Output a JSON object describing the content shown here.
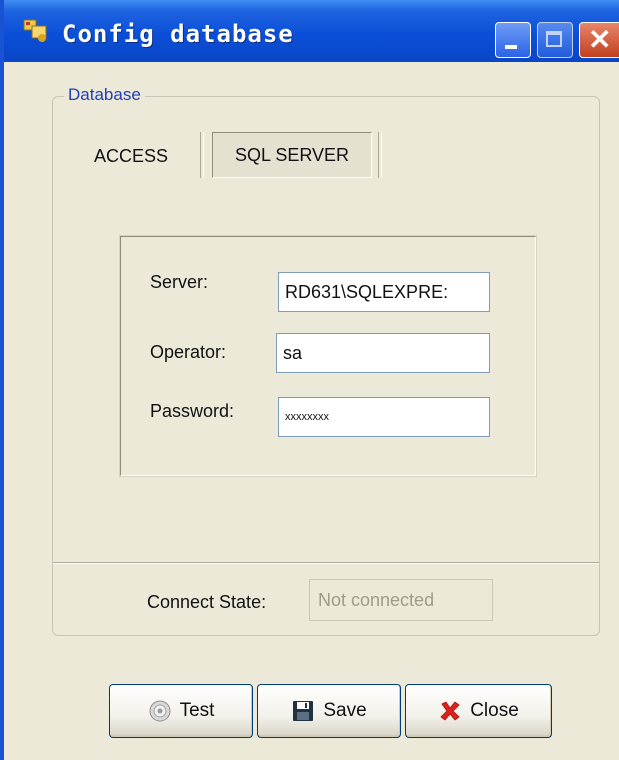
{
  "window": {
    "title": "Config database"
  },
  "groupbox": {
    "legend": "Database"
  },
  "tabs": [
    {
      "label": "ACCESS",
      "selected": false
    },
    {
      "label": "SQL SERVER",
      "selected": true
    }
  ],
  "fields": {
    "server_label": "Server:",
    "server_value": "RD631\\SQLEXPRE:",
    "operator_label": "Operator:",
    "operator_value": "sa",
    "password_label": "Password:",
    "password_value": "xxxxxxxx"
  },
  "connect": {
    "label": "Connect State:",
    "value": "Not connected"
  },
  "buttons": {
    "test": "Test",
    "save": "Save",
    "close": "Close"
  },
  "icons": {
    "title": "app-keys-icon",
    "test": "disc-icon",
    "save": "floppy-disk-icon",
    "close": "red-x-icon"
  },
  "colors": {
    "titlebar": "#0b4fd8",
    "legend": "#1f3fb8",
    "close_x": "#e0201a",
    "window_bg": "#ece9d8"
  }
}
